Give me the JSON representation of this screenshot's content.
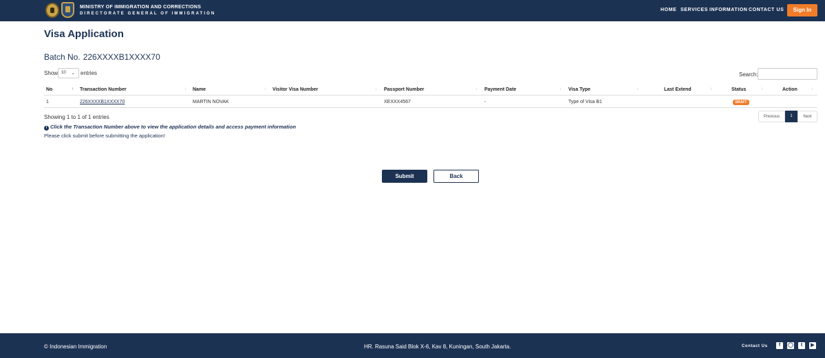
{
  "header": {
    "ministry": "MINISTRY OF IMMIGRATION AND CORRECTIONS",
    "directorate": "DIRECTORATE GENERAL OF IMMIGRATION",
    "nav": [
      "HOME",
      "SERVICES",
      "INFORMATION",
      "CONTACT US"
    ],
    "sign_in": "Sign In"
  },
  "page": {
    "title": "Visa Application",
    "batch_label": "Batch No.",
    "batch_value": "226XXXXB1XXXX70"
  },
  "table_controls": {
    "show_label": "Show",
    "page_length": "10",
    "entries_label": "entries",
    "search_label": "Search:",
    "search_value": ""
  },
  "table": {
    "columns": [
      "No",
      "Transaction Number",
      "Name",
      "Visitor Visa Number",
      "Passport Number",
      "Payment Date",
      "Visa Type",
      "Last Extend",
      "Status",
      "Action"
    ],
    "rows": [
      {
        "no": "1",
        "transaction_number": "226XXXXB1XXXX70",
        "name": "MARTIN NOVAK",
        "visitor_visa_number": "",
        "passport_number": "XEXXX4567",
        "payment_date": "-",
        "visa_type": "Type of Visa B1",
        "last_extend": "",
        "status": "DRAFT",
        "action": ""
      }
    ]
  },
  "table_info": "Showing 1 to 1 of 1 entries",
  "pagination": {
    "previous": "Previous",
    "current": "1",
    "next": "Next"
  },
  "hint": "Click the Transaction Number above to view the application details and access payment information",
  "notice": "Please click submit before submitting the application!",
  "buttons": {
    "submit": "Submit",
    "back": "Back"
  },
  "footer": {
    "copyright": "© Indonesian Immigration",
    "address": "HR. Rasuna Said Blok X-6, Kav 8, Kuningan, South Jakarta.",
    "contact": "Contact Us",
    "social_icons": [
      "facebook-icon",
      "instagram-icon",
      "twitter-icon",
      "youtube-icon"
    ]
  },
  "colors": {
    "primary": "#1c3253",
    "accent": "#f07c29"
  }
}
